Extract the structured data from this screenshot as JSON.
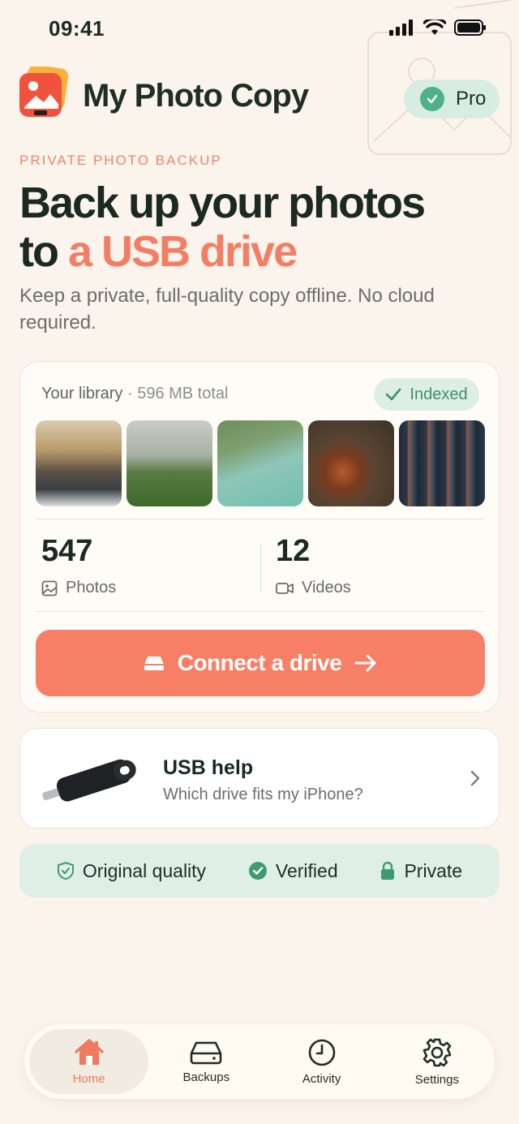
{
  "status_bar": {
    "time": "09:41"
  },
  "header": {
    "app_title": "My Photo Copy",
    "pro_label": "Pro"
  },
  "hero": {
    "eyebrow": "PRIVATE PHOTO BACKUP",
    "title_line1": "Back up your photos",
    "title_line2_prefix": "to ",
    "title_line2_accent": "a USB drive",
    "subtitle": "Keep a private, full-quality copy offline. No cloud required."
  },
  "library": {
    "label": "Your library",
    "separator": " · ",
    "size": "596 MB total",
    "indexed_label": "Indexed",
    "photos_count": "547",
    "photos_label": "Photos",
    "videos_count": "12",
    "videos_label": "Videos",
    "connect_label": "Connect a drive"
  },
  "usb_help": {
    "title": "USB help",
    "subtitle": "Which drive fits my iPhone?"
  },
  "trust": [
    {
      "label": "Original quality",
      "icon": "shield-check-icon"
    },
    {
      "label": "Verified",
      "icon": "check-circle-icon"
    },
    {
      "label": "Private",
      "icon": "lock-icon"
    }
  ],
  "tabs": [
    {
      "label": "Home",
      "icon": "home-icon",
      "active": true
    },
    {
      "label": "Backups",
      "icon": "drive-icon",
      "active": false
    },
    {
      "label": "Activity",
      "icon": "clock-icon",
      "active": false
    },
    {
      "label": "Settings",
      "icon": "gear-icon",
      "active": false
    }
  ],
  "colors": {
    "accent": "#f77f65",
    "green": "#4fb08a",
    "background": "#fbf4ec"
  }
}
